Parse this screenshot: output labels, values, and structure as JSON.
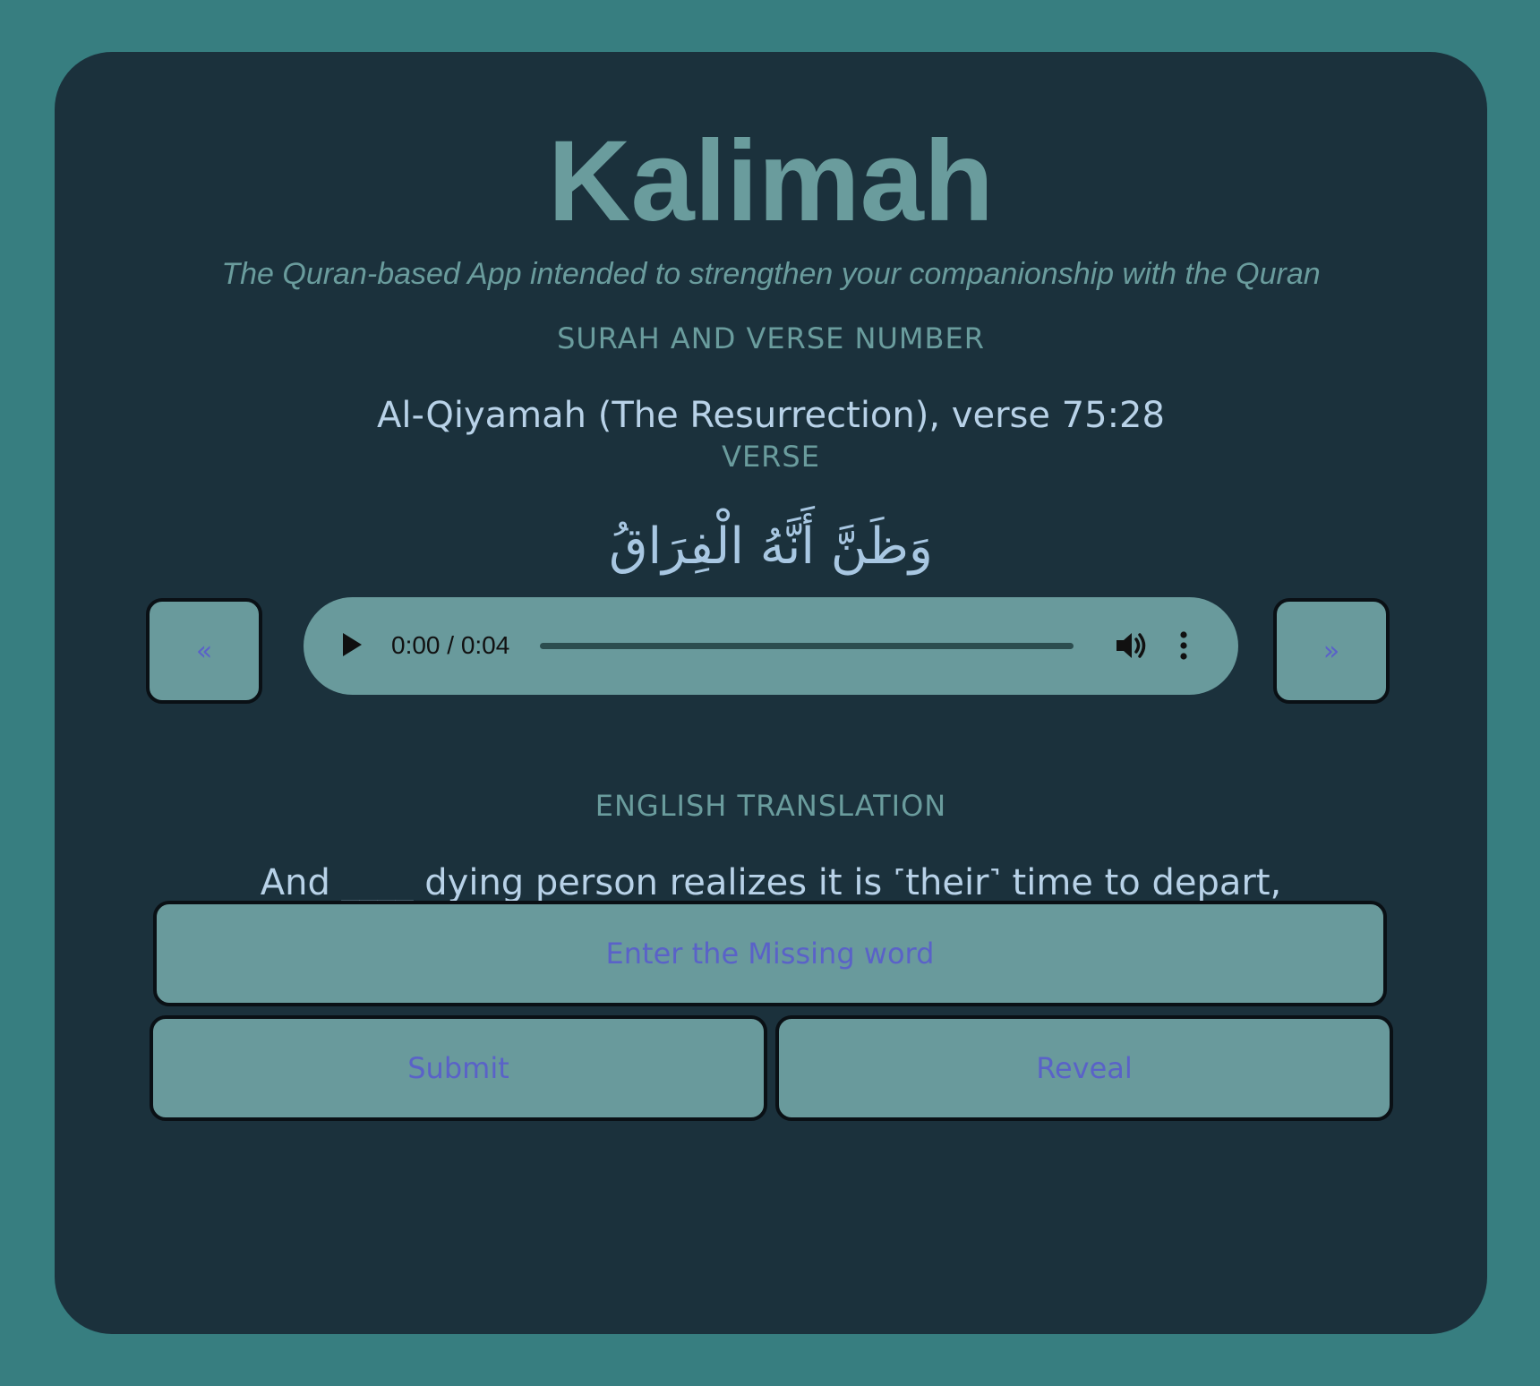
{
  "app": {
    "title": "Kalimah",
    "tagline": "The Quran-based App intended to strengthen your companionship with the Quran"
  },
  "sections": {
    "surah_label": "SURAH AND VERSE NUMBER",
    "surah_value": "Al-Qiyamah (The Resurrection), verse 75:28",
    "verse_label": "VERSE",
    "verse_arabic": "وَظَنَّ أَنَّهُ الْفِرَاقُ",
    "translation_label": "ENGLISH TRANSLATION",
    "translation_text": "And ____ dying person realizes it is ˹their˺ time to depart,"
  },
  "nav": {
    "prev_label": "«",
    "next_label": "»"
  },
  "audio": {
    "time": "0:00 / 0:04",
    "progress": 0,
    "play_icon": "play-icon",
    "volume_icon": "volume-icon",
    "more_icon": "more-vertical-icon"
  },
  "quiz": {
    "input_value": "",
    "input_placeholder": "Enter the Missing word",
    "submit_label": "Submit",
    "reveal_label": "Reveal"
  },
  "colors": {
    "page_background": "#377e80",
    "card_background": "#1b313c",
    "title_color": "#6a9c9d",
    "text_color": "#b8d2e8",
    "control_background": "#699a9c",
    "control_text": "#5a62c8"
  }
}
